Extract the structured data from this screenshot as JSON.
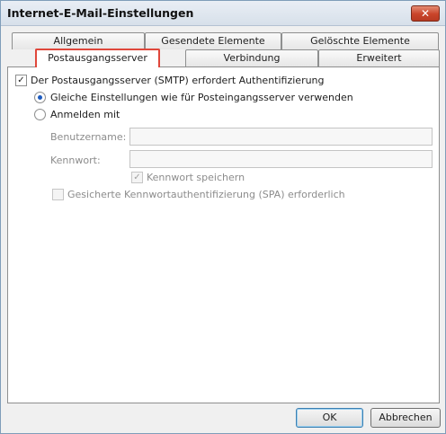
{
  "window": {
    "title": "Internet-E-Mail-Einstellungen",
    "close_label": "✕"
  },
  "tabs": {
    "row1": [
      "Allgemein",
      "Gesendete Elemente",
      "Gelöschte Elemente"
    ],
    "row2": [
      "Postausgangsserver",
      "Verbindung",
      "Erweitert"
    ],
    "active": "Postausgangsserver"
  },
  "smtp": {
    "requires_auth_label": "Der Postausgangsserver (SMTP) erfordert Authentifizierung",
    "requires_auth_checked": true,
    "same_settings_label": "Gleiche Einstellungen wie für Posteingangsserver verwenden",
    "same_settings_selected": true,
    "login_with_label": "Anmelden mit",
    "login_with_selected": false,
    "username_label": "Benutzername:",
    "username_value": "",
    "password_label": "Kennwort:",
    "password_value": "",
    "remember_password_label": "Kennwort speichern",
    "remember_password_checked": true,
    "spa_label": "Gesicherte Kennwortauthentifizierung (SPA) erforderlich",
    "spa_checked": false
  },
  "buttons": {
    "ok": "OK",
    "cancel": "Abbrechen"
  },
  "marks": {
    "check": "✓"
  }
}
